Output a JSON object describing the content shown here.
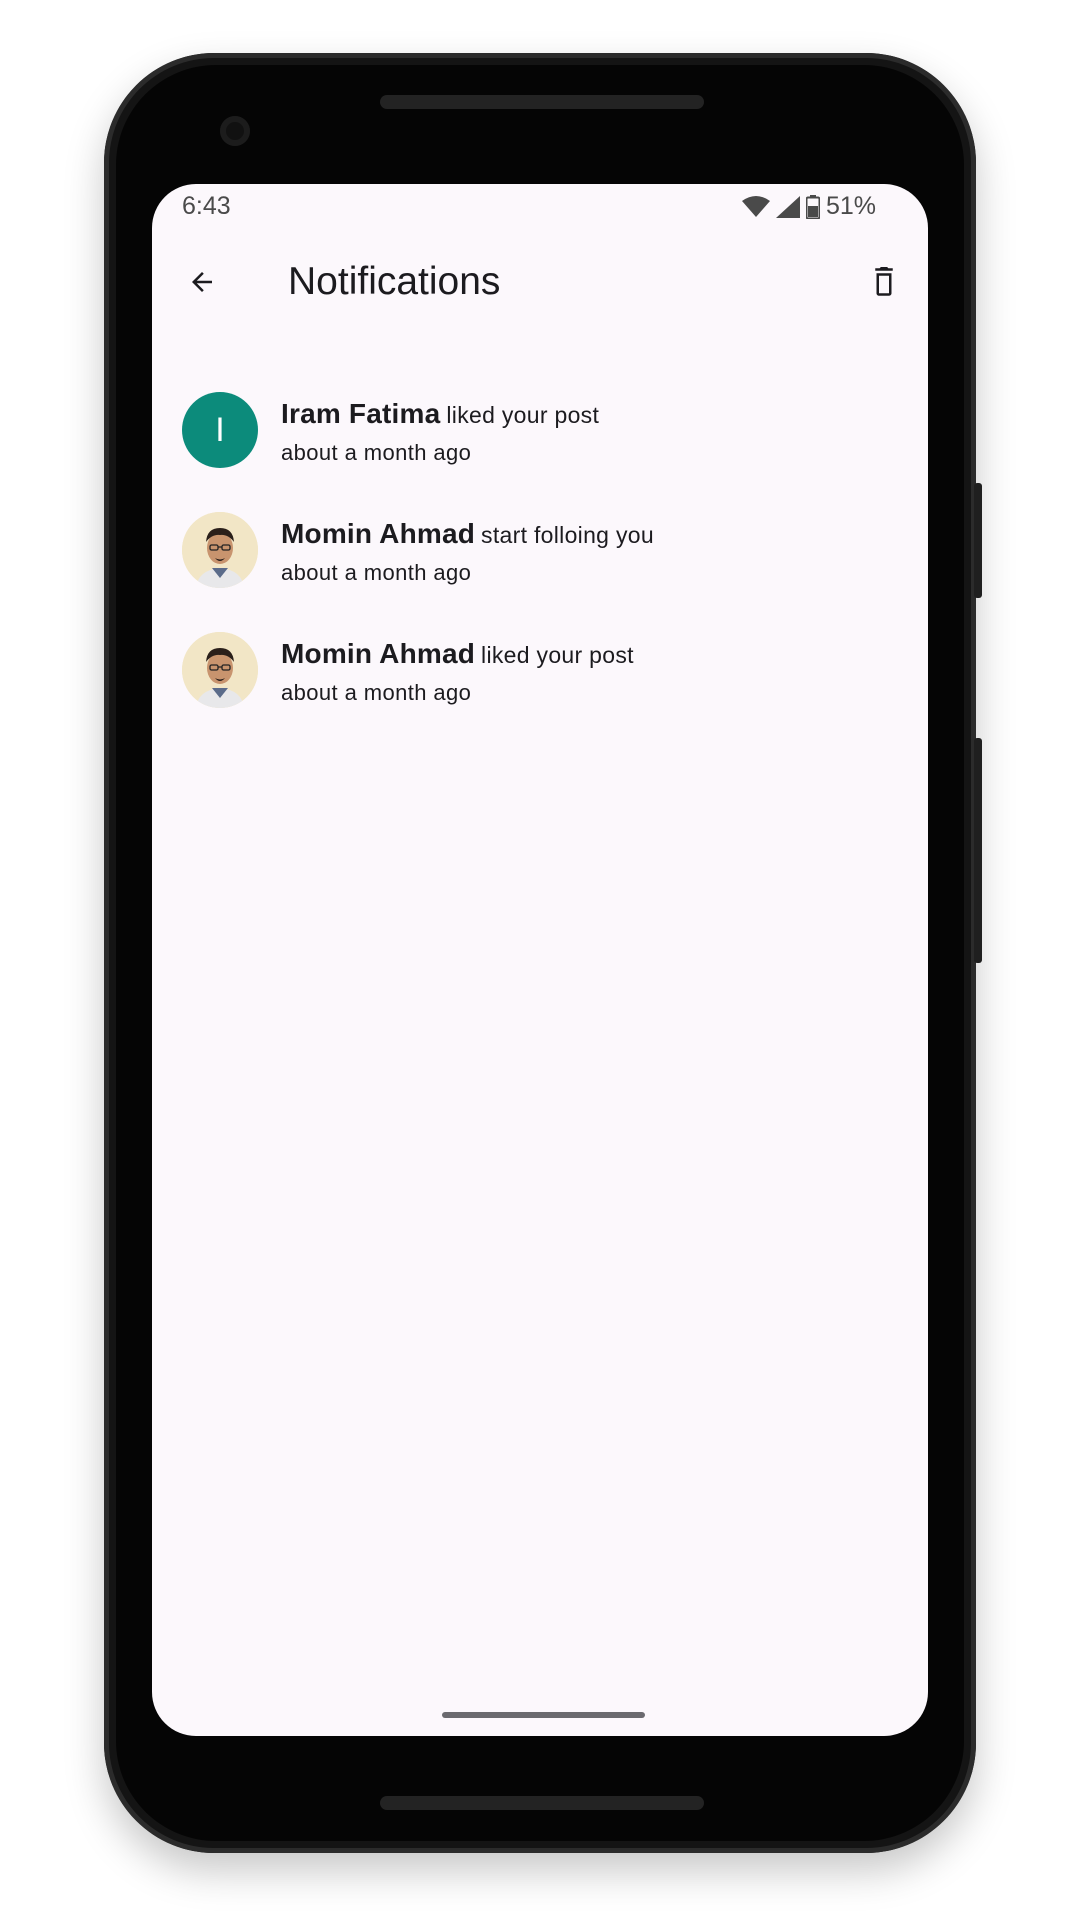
{
  "status_bar": {
    "time": "6:43",
    "battery": "51%",
    "icons": [
      "wifi-icon",
      "signal-icon",
      "battery-icon"
    ]
  },
  "app_bar": {
    "title": "Notifications",
    "back_icon": "arrow-back-icon",
    "delete_icon": "delete-icon"
  },
  "notifications": [
    {
      "name": "Iram Fatima",
      "action": "liked your post",
      "time": "about a month ago",
      "avatar_type": "letter",
      "avatar_letter": "I",
      "avatar_color": "#0c8b7b"
    },
    {
      "name": "Momin Ahmad",
      "action": "start folloing you",
      "time": "about a month ago",
      "avatar_type": "photo"
    },
    {
      "name": "Momin Ahmad",
      "action": "liked your post",
      "time": "about a month ago",
      "avatar_type": "photo"
    }
  ],
  "colors": {
    "screen_bg": "#fcf8fc",
    "text": "#1c1b1f",
    "accent_avatar": "#0c8b7b"
  }
}
